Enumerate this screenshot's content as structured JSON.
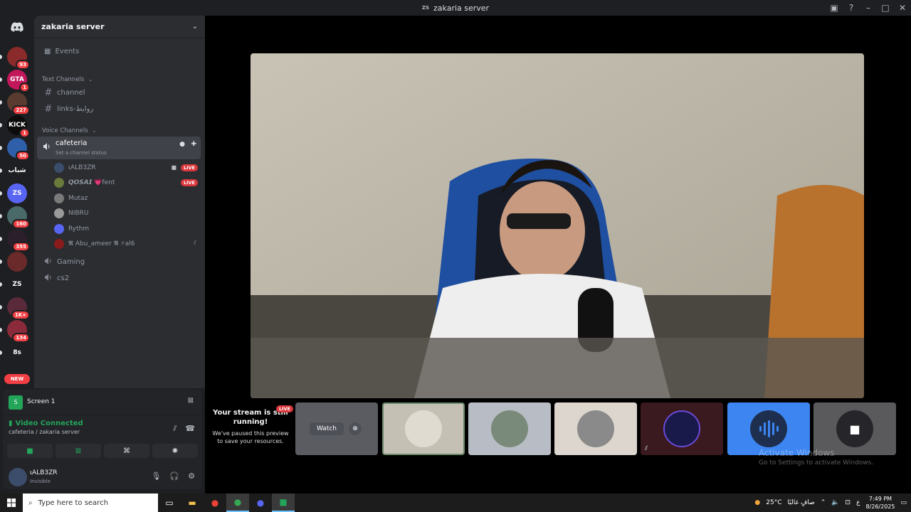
{
  "window": {
    "title": "zakaria server",
    "title_icon": "ZS"
  },
  "rail": {
    "servers": [
      {
        "label": "",
        "badge": "93",
        "color": "#8b2a2a"
      },
      {
        "label": "GTA",
        "badge": "1",
        "color": "#c2185b"
      },
      {
        "label": "",
        "badge": "227",
        "color": "#5a3b2f"
      },
      {
        "label": "KICK",
        "badge": "1",
        "color": "#0c0c0c"
      },
      {
        "label": "",
        "badge": "50",
        "color": "#2f5fa8"
      },
      {
        "label": "شباب",
        "badge": "",
        "color": "#1e1f22"
      },
      {
        "label": "ZS",
        "badge": "",
        "color": "#5865f2"
      },
      {
        "label": "",
        "badge": "160",
        "color": "#4a6a6a"
      },
      {
        "label": "",
        "badge": "355",
        "color": "#2a1f2a"
      },
      {
        "label": "",
        "badge": "",
        "color": "#6a2a2a"
      },
      {
        "label": "ZS",
        "badge": "",
        "color": "#1e1f22"
      },
      {
        "label": "",
        "badge": "1K+",
        "color": "#5a2a3a"
      },
      {
        "label": "",
        "badge": "134",
        "color": "#8b2a3a"
      },
      {
        "label": "8s",
        "badge": "",
        "color": "#1e1f22"
      }
    ],
    "new_label": "NEW"
  },
  "sidebar": {
    "server_name": "zakaria server",
    "events_label": "Events",
    "text_category": "Text Channels",
    "text_channels": [
      "channel",
      "links-روابط"
    ],
    "voice_category": "Voice Channels",
    "active_channel": {
      "name": "cafeteria",
      "status": "Set a channel status"
    },
    "members": [
      {
        "name": "ιALB3ZR",
        "live": "LIVE",
        "camera": true,
        "color": "#3b4d6a"
      },
      {
        "name": "𝙌𝙊𝙎𝘼𝙄 💗fent",
        "live": "LIVE",
        "camera": false,
        "color": "#6a7a3a"
      },
      {
        "name": "Mutaz",
        "live": "",
        "camera": false,
        "color": "#7a7a7a"
      },
      {
        "name": "NIBRU",
        "live": "",
        "camera": false,
        "color": "#9a9a9a"
      },
      {
        "name": "Rythm",
        "live": "",
        "camera": false,
        "color": "#5865f2"
      },
      {
        "name": "𝕽 Abu_ameer 𝕽 ⚡al6",
        "live": "",
        "camera": false,
        "color": "#8b1a1a"
      }
    ],
    "other_voice": [
      "Gaming",
      "cs2"
    ]
  },
  "panel": {
    "screen_label": "Screen 1",
    "connection_status": "Video Connected",
    "connection_location": "cafeteria / zakaria server",
    "username": "ιALB3ZR",
    "user_status": "Invisible"
  },
  "stage": {
    "notice_title": "Your stream is still running!",
    "notice_body": "We've paused this preview to save your resources.",
    "notice_live": "LIVE",
    "watch_label": "Watch",
    "watermark_title": "Activate Windows",
    "watermark_body": "Go to Settings to activate Windows."
  },
  "taskbar": {
    "search_placeholder": "Type here to search",
    "weather": "25°C",
    "weather_text": "صافٍ غالبًا",
    "language": "ع",
    "time": "7:49 PM",
    "date": "8/26/2025"
  }
}
